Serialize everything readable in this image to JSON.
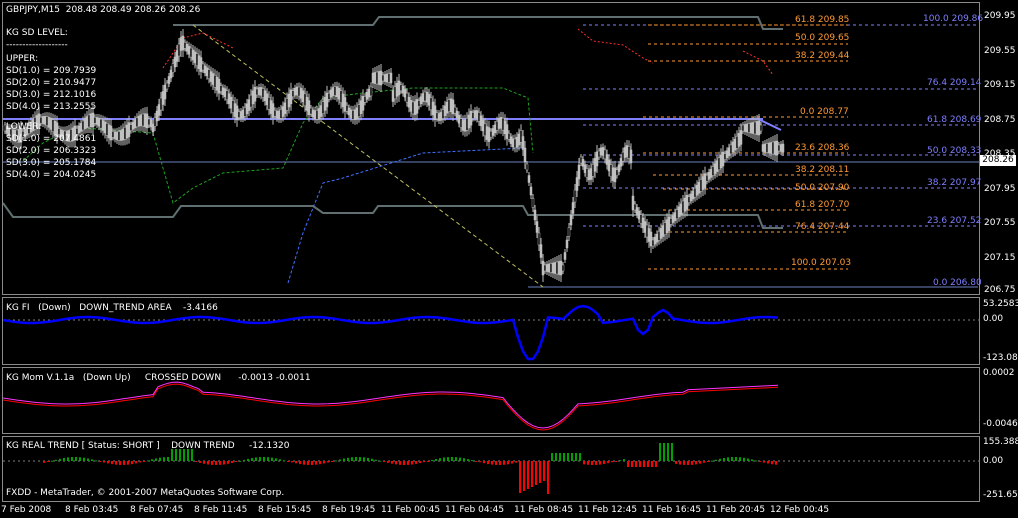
{
  "main": {
    "symbol_info": "GBPJPY,M15  208.48 208.49 208.26 208.26",
    "kg_sd": {
      "title": "KG SD LEVEL:",
      "separator": "-------------------",
      "upper_label": "UPPER:",
      "upper": [
        "SD(1.0) = 209.7939",
        "SD(2.0) = 210.9477",
        "SD(3.0) = 212.1016",
        "SD(4.0) = 213.2555"
      ],
      "lower_label": "LOWER:",
      "lower": [
        "SD(1.0) = 207.4861",
        "SD(2.0) = 206.3323",
        "SD(3.0) = 205.1784",
        "SD(4.0) = 204.0245"
      ]
    },
    "current_price": "208.26",
    "price_axis": [
      "209.95",
      "209.55",
      "209.15",
      "208.75",
      "208.35",
      "207.95",
      "207.55",
      "207.15",
      "206.75"
    ],
    "fib_right": [
      "100.0  209.86",
      "76.4  209.14",
      "61.8  208.69",
      "50.0  208.33",
      "38.2  207.97",
      "23.6  207.52",
      "0.0  206.80"
    ],
    "fib_mid": [
      "61.8  209.85",
      "50.0  209.65",
      "38.2  209.44",
      "0.0  208.77",
      "23.6  208.36",
      "38.2  208.11",
      "50.0  207.90",
      "61.8  207.70",
      "76.4  207.44",
      "100.0  207.03"
    ]
  },
  "fi": {
    "label": "KG FI   (Down)   DOWN_TREND AREA    -3.4166",
    "axis": [
      "53.2583",
      "0.00",
      "-123.081"
    ]
  },
  "mom": {
    "label": "KG Mom V.1.1a   (Down Up)     CROSSED DOWN      -0.0013 -0.0011",
    "axis": [
      "0.0002",
      "-0.0046"
    ]
  },
  "trend": {
    "label": "KG REAL TREND [ Status: SHORT ]    DOWN TREND     -12.1320",
    "axis": [
      "155.3889",
      "0.00",
      "-251.6514"
    ],
    "copyright": "FXDD - MetaTrader, © 2001-2007 MetaQuotes Software Corp."
  },
  "time_axis": [
    "7 Feb 2008",
    "8 Feb 03:45",
    "8 Feb 07:45",
    "8 Feb 11:45",
    "8 Feb 15:45",
    "8 Feb 19:45",
    "11 Feb 00:45",
    "11 Feb 04:45",
    "11 Feb 08:45",
    "11 Feb 12:45",
    "11 Feb 16:45",
    "11 Feb 20:45",
    "12 Feb 00:45"
  ],
  "colors": {
    "background": "#000000",
    "candles": "#c0c0c0",
    "fib_blue": "#7f7fff",
    "fib_orange": "#ff9933",
    "sd_line": "#6b7fc0",
    "fi_line": "#0000ff",
    "mom_red": "#ff0000",
    "mom_magenta": "#ff33ff",
    "bar_up": "#00a000",
    "bar_down": "#ff0000"
  }
}
